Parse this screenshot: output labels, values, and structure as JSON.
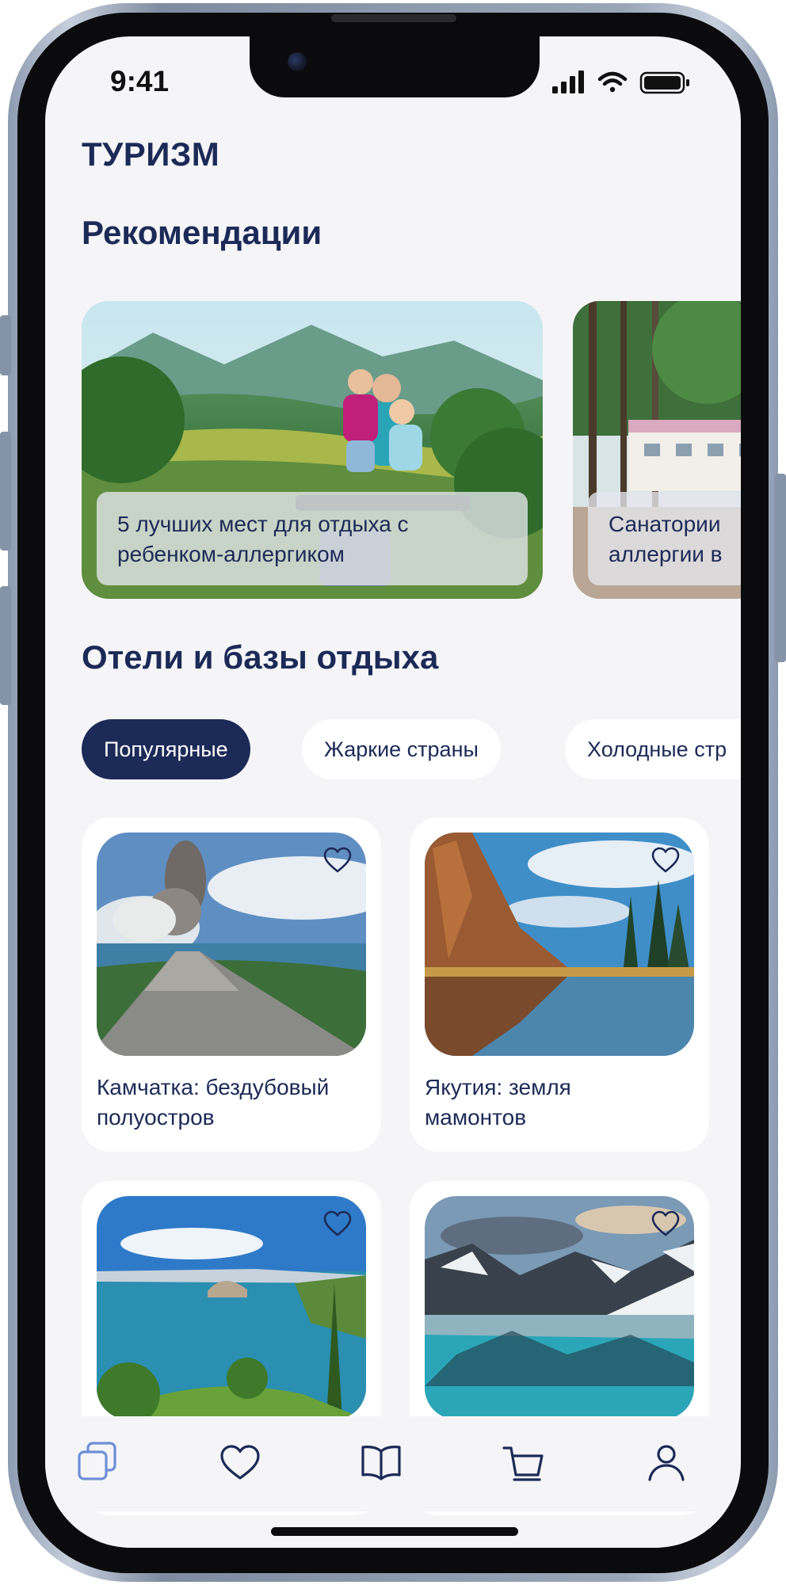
{
  "status_bar": {
    "time": "9:41"
  },
  "app": {
    "title": "ТУРИЗМ"
  },
  "recommendations": {
    "title": "Рекомендации",
    "cards": [
      {
        "caption": "5 лучших мест для отдыха с\nребенком-аллергиком"
      },
      {
        "caption": "Санатории\nаллергии в"
      }
    ]
  },
  "hotels": {
    "title": "Отели и базы отдыха",
    "chips": [
      {
        "label": "Популярные",
        "active": true
      },
      {
        "label": "Жаркие страны",
        "active": false
      },
      {
        "label": "Холодные стр",
        "active": false
      }
    ],
    "places": [
      {
        "title": "Камчатка: бездубовый\nполуостров",
        "favorite_icon": "heart-outline-icon"
      },
      {
        "title": "Якутия: земля\nмамонтов",
        "favorite_icon": "heart-outline-icon"
      },
      {
        "title": "",
        "favorite_icon": "heart-outline-icon"
      },
      {
        "title": "",
        "favorite_icon": "heart-outline-icon"
      }
    ]
  },
  "tabbar": {
    "items": [
      {
        "icon": "catalog-icon",
        "active": true
      },
      {
        "icon": "heart-icon",
        "active": false
      },
      {
        "icon": "book-icon",
        "active": false
      },
      {
        "icon": "cart-icon",
        "active": false
      },
      {
        "icon": "profile-icon",
        "active": false
      }
    ]
  },
  "colors": {
    "brand_navy": "#1c2a57",
    "screen_bg": "#f5f5f8",
    "tab_active": "#6d8fd6",
    "tab_inactive": "#1c2a57"
  }
}
